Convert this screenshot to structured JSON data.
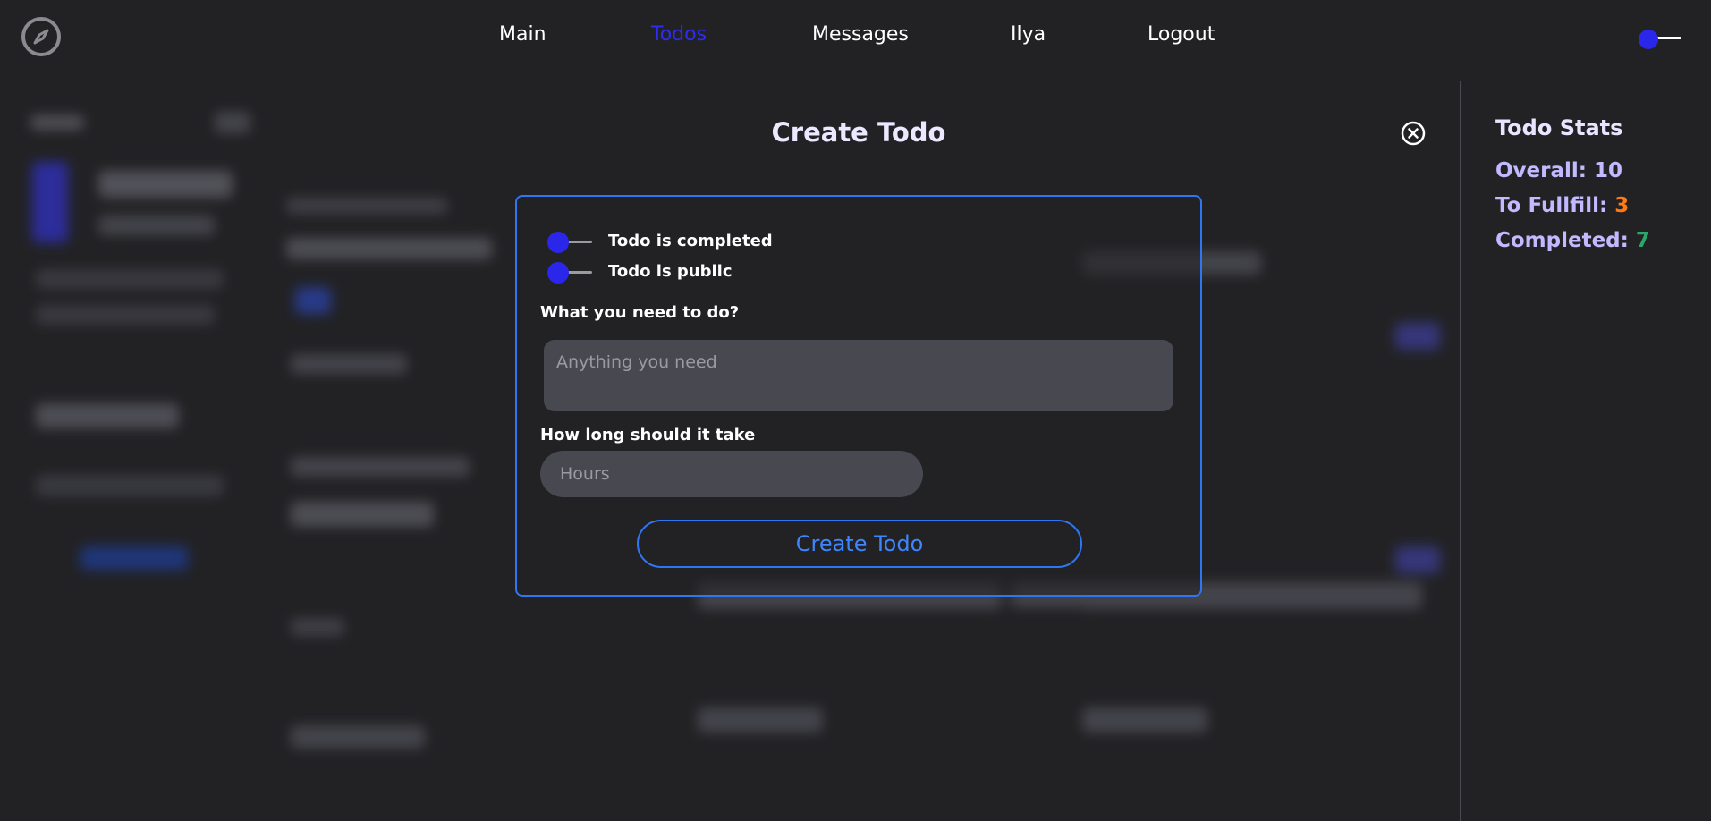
{
  "nav": {
    "items": [
      {
        "label": "Main",
        "active": false
      },
      {
        "label": "Todos",
        "active": true
      },
      {
        "label": "Messages",
        "active": false
      },
      {
        "label": "Ilya",
        "active": false
      },
      {
        "label": "Logout",
        "active": false
      }
    ],
    "logo_icon": "compass-icon",
    "theme_toggle_icon": "toggle-icon"
  },
  "modal": {
    "title": "Create Todo",
    "close_icon": "close-circle-icon",
    "completed_label": "Todo is completed",
    "public_label": "Todo is public",
    "text_label": "What you need to do?",
    "text_placeholder": "Anything you need",
    "hours_label": "How long should it take",
    "hours_placeholder": "Hours",
    "submit_label": "Create Todo"
  },
  "stats": {
    "title": "Todo Stats",
    "overall_label": "Overall:",
    "overall_value": "10",
    "to_fulfill_label": "To Fullfill:",
    "to_fulfill_value": "3",
    "completed_label": "Completed:",
    "completed_value": "7"
  },
  "colors": {
    "accent": "#2a27ea",
    "active_nav": "#2c2cf2",
    "border_blue": "#2f76f2",
    "orange": "#ff7a14",
    "green": "#28a86a",
    "background": "#222225"
  }
}
